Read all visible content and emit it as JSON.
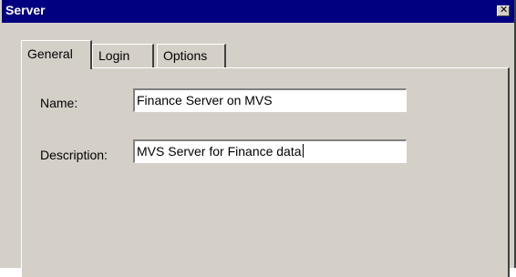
{
  "window": {
    "title": "Server",
    "close_glyph": "✕"
  },
  "tabs": [
    {
      "label": "General",
      "active": true
    },
    {
      "label": "Login",
      "active": false
    },
    {
      "label": "Options",
      "active": false
    }
  ],
  "form": {
    "name_label": "Name:",
    "name_value": "Finance Server on MVS",
    "description_label": "Description:",
    "description_value": "MVS Server for Finance data"
  },
  "colors": {
    "titlebar": "#000080",
    "face": "#d4d0c8"
  }
}
